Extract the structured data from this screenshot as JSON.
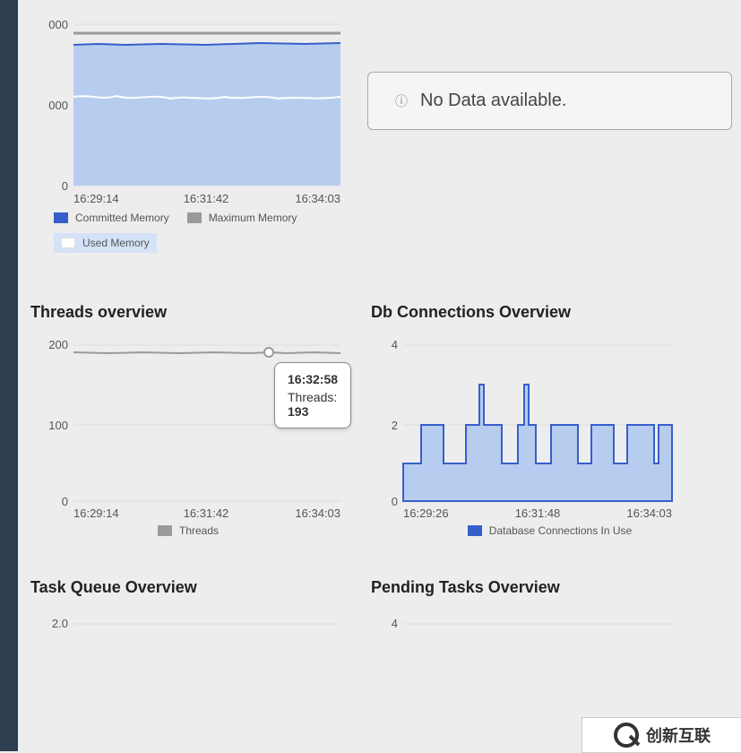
{
  "memory": {
    "ylabels": [
      "000",
      "000",
      "0"
    ],
    "xlabels": [
      "16:29:14",
      "16:31:42",
      "16:34:03"
    ],
    "legend_committed": "Committed Memory",
    "legend_maximum": "Maximum Memory",
    "legend_used": "Used Memory"
  },
  "nodata": {
    "text": "No Data available."
  },
  "threads": {
    "title": "Threads overview",
    "ylabels": [
      "200",
      "100",
      "0"
    ],
    "xlabels": [
      "16:29:14",
      "16:31:42",
      "16:34:03"
    ],
    "legend": "Threads",
    "tooltip_time": "16:32:58",
    "tooltip_label": "Threads: ",
    "tooltip_value": "193"
  },
  "db": {
    "title": "Db Connections Overview",
    "ylabels": [
      "4",
      "2",
      "0"
    ],
    "xlabels": [
      "16:29:26",
      "16:31:48",
      "16:34:03"
    ],
    "legend": "Database Connections In Use"
  },
  "taskq": {
    "title": "Task Queue Overview",
    "y0": "2.0"
  },
  "pending": {
    "title": "Pending Tasks Overview",
    "y0": "4"
  },
  "logo": "创新互联",
  "chart_data": [
    {
      "type": "area",
      "title": "Memory",
      "xlabel": "",
      "ylabel": "",
      "x_ticks": [
        "16:29:14",
        "16:31:42",
        "16:34:03"
      ],
      "y_ticks": [
        "0",
        "000",
        "000"
      ],
      "series": [
        {
          "name": "Maximum Memory",
          "values": [
            1.86,
            1.86,
            1.86,
            1.86,
            1.86,
            1.86,
            1.86,
            1.86,
            1.86,
            1.86,
            1.86,
            1.86,
            1.86,
            1.86,
            1.86,
            1.86,
            1.86,
            1.86,
            1.86,
            1.86
          ],
          "note": "flat gray line near top"
        },
        {
          "name": "Committed Memory",
          "values": [
            1.72,
            1.73,
            1.72,
            1.73,
            1.73,
            1.72,
            1.71,
            1.72,
            1.73,
            1.72,
            1.73,
            1.72,
            1.73,
            1.74,
            1.73,
            1.72,
            1.73,
            1.72,
            1.73,
            1.72
          ],
          "note": "blue area fill upper boundary"
        },
        {
          "name": "Used Memory",
          "values": [
            1.12,
            1.1,
            1.14,
            1.09,
            1.11,
            1.13,
            1.08,
            1.12,
            1.15,
            1.11,
            1.1,
            1.13,
            1.09,
            1.12,
            1.14,
            1.1,
            1.11,
            1.13,
            1.12,
            1.11
          ],
          "note": "white wavy line over area"
        }
      ],
      "ylim_note": "axis tick text truncated to '000' / '000' / '0' in screenshot"
    },
    {
      "type": "line",
      "title": "Threads overview",
      "xlabel": "",
      "ylabel": "",
      "x_ticks": [
        "16:29:14",
        "16:31:42",
        "16:34:03"
      ],
      "ylim": [
        0,
        200
      ],
      "series": [
        {
          "name": "Threads",
          "x": [
            "16:29:14",
            "16:29:40",
            "16:30:10",
            "16:30:40",
            "16:31:10",
            "16:31:42",
            "16:32:10",
            "16:32:40",
            "16:32:58",
            "16:33:20",
            "16:33:40",
            "16:34:03"
          ],
          "values": [
            192,
            193,
            192,
            193,
            192,
            193,
            192,
            193,
            193,
            192,
            192,
            192
          ]
        }
      ],
      "tooltip": {
        "x": "16:32:58",
        "Threads": 193
      }
    },
    {
      "type": "area",
      "title": "Db Connections Overview",
      "xlabel": "",
      "ylabel": "",
      "x_ticks": [
        "16:29:26",
        "16:31:48",
        "16:34:03"
      ],
      "ylim": [
        0,
        4
      ],
      "series": [
        {
          "name": "Database Connections In Use",
          "x": [
            "16:29:26",
            "16:29:50",
            "16:30:00",
            "16:30:20",
            "16:30:30",
            "16:30:50",
            "16:31:00",
            "16:31:05",
            "16:31:10",
            "16:31:20",
            "16:31:40",
            "16:31:48",
            "16:31:50",
            "16:31:55",
            "16:32:00",
            "16:32:10",
            "16:32:20",
            "16:32:40",
            "16:32:50",
            "16:33:00",
            "16:33:10",
            "16:33:20",
            "16:33:30",
            "16:33:40",
            "16:33:50",
            "16:34:03"
          ],
          "values": [
            1,
            1,
            2,
            2,
            1,
            1,
            2,
            3,
            2,
            2,
            1,
            2,
            3,
            2,
            1,
            1,
            2,
            2,
            1,
            1,
            2,
            2,
            1,
            1,
            2,
            2
          ]
        }
      ]
    },
    {
      "type": "line",
      "title": "Task Queue Overview",
      "ylim_top": 2.0,
      "series": [],
      "note": "only top y-tick '2.0' visible in crop"
    },
    {
      "type": "line",
      "title": "Pending Tasks Overview",
      "ylim_top": 4,
      "series": [],
      "note": "only top y-tick '4' visible in crop"
    }
  ]
}
